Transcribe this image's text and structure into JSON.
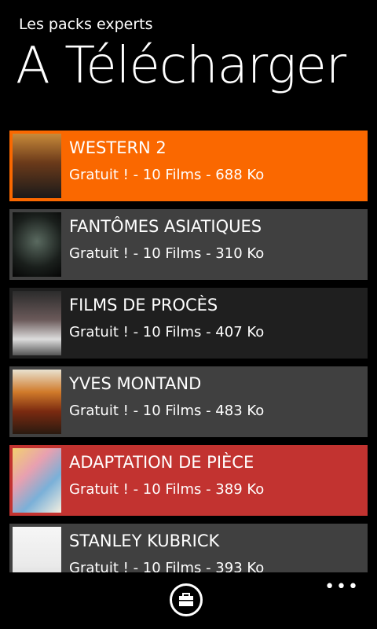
{
  "header": {
    "subtitle": "Les packs experts",
    "title": "A Télécharger"
  },
  "items": [
    {
      "name": "WESTERN 2",
      "meta": "Gratuit ! - 10 Films - 688 Ko",
      "color": "#FA6800"
    },
    {
      "name": "FANTÔMES ASIATIQUES",
      "meta": "Gratuit ! - 10 Films - 310 Ko",
      "color": "#404040"
    },
    {
      "name": "FILMS DE PROCÈS",
      "meta": "Gratuit ! - 10 Films - 407 Ko",
      "color": "#1f1f1f"
    },
    {
      "name": "YVES MONTAND",
      "meta": "Gratuit ! - 10 Films - 483 Ko",
      "color": "#404040"
    },
    {
      "name": "ADAPTATION DE PIÈCE",
      "meta": "Gratuit ! - 10 Films - 389 Ko",
      "color": "#C23330"
    },
    {
      "name": "STANLEY KUBRICK",
      "meta": "Gratuit ! - 10 Films - 393 Ko",
      "color": "#404040"
    }
  ],
  "appbar": {
    "main_icon": "briefcase-icon",
    "more_label": "•••"
  }
}
